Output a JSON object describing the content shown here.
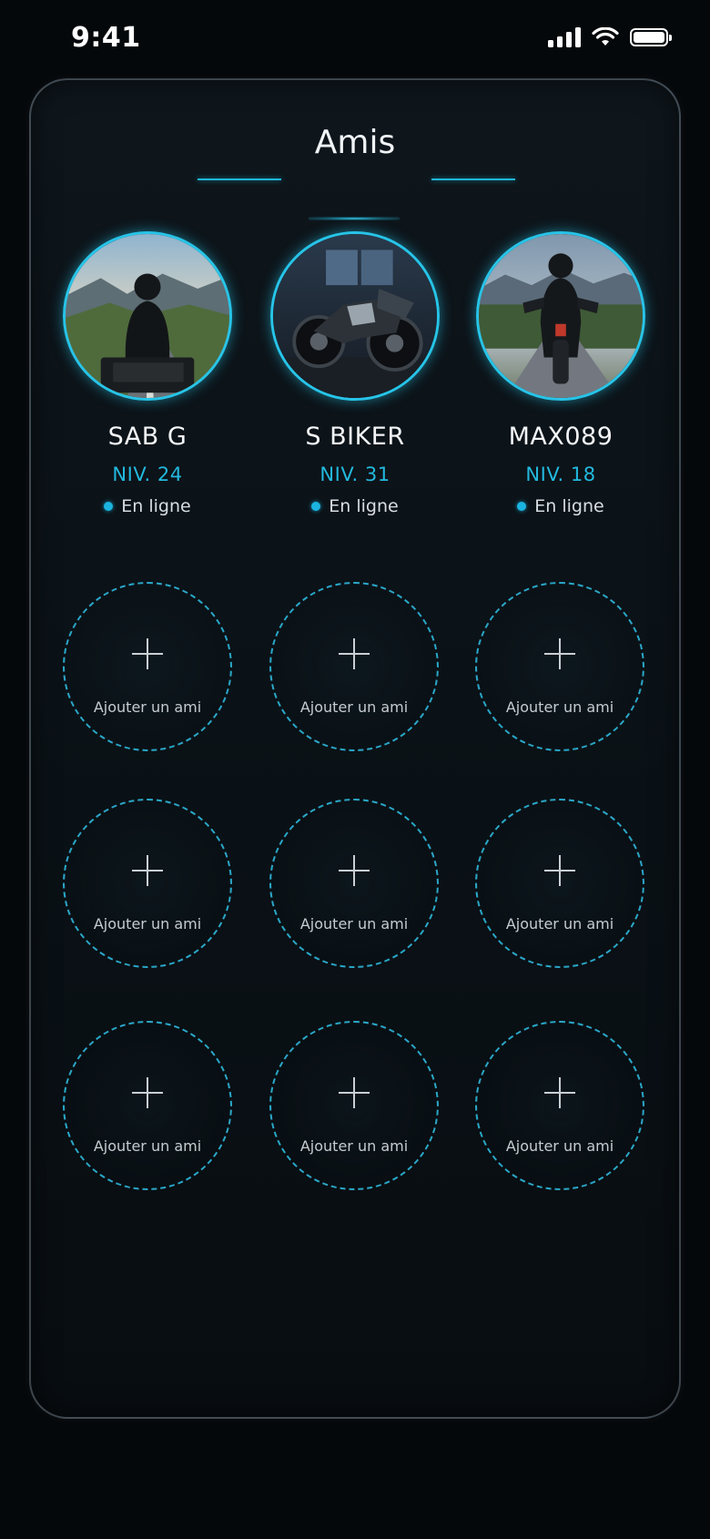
{
  "status_bar": {
    "time": "9:41"
  },
  "page": {
    "title": "Amis"
  },
  "friends": [
    {
      "name": "SAB G",
      "level": "NIV. 24",
      "status": "En ligne"
    },
    {
      "name": "S BIKER",
      "level": "NIV. 31",
      "status": "En ligne"
    },
    {
      "name": "MAX089",
      "level": "NIV. 18",
      "status": "En ligne"
    }
  ],
  "add_slots": {
    "label": "Ajouter un ami",
    "count": 9
  },
  "colors": {
    "accent": "#27c4e8",
    "background": "#05080b",
    "panel": "#0c1419"
  }
}
